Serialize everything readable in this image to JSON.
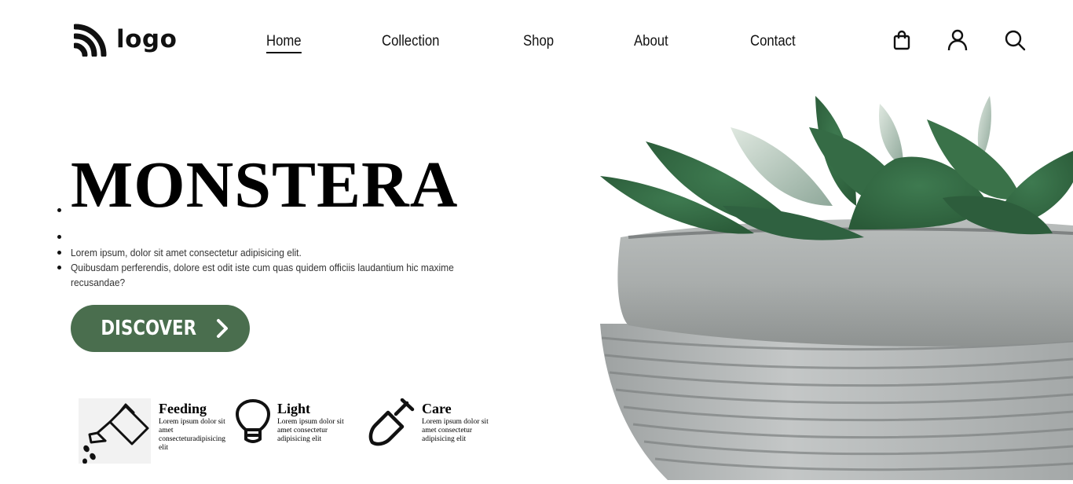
{
  "header": {
    "logo_text": "logo",
    "nav": [
      {
        "label": "Home",
        "active": true
      },
      {
        "label": "Collection",
        "active": false
      },
      {
        "label": "Shop",
        "active": false
      },
      {
        "label": "About",
        "active": false
      },
      {
        "label": "Contact",
        "active": false
      }
    ],
    "icons": [
      "shopping-bag-icon",
      "user-icon",
      "search-icon"
    ]
  },
  "hero": {
    "title": "MONSTERA",
    "lines": [
      "Lorem ipsum, dolor sit amet consectetur adipisicing elit.",
      "Quibusdam perferendis, dolore est odit iste cum quas quidem officiis laudantium hic maxime",
      "recusandae?"
    ],
    "button_label": "DISCOVER",
    "button_color": "#4a6e4e"
  },
  "features": [
    {
      "title": "Feeding",
      "text": "Lorem ipsum dolor sit amet consecteturadipisicing elit",
      "icon": "watering-can-icon"
    },
    {
      "title": "Light",
      "text": "Lorem ipsum dolor sit amet consectetur adipisicing elit",
      "icon": "light-bulb-icon"
    },
    {
      "title": "Care",
      "text": "Lorem ipsum dolor sit amet consectetur adipisicing elit",
      "icon": "shovel-icon"
    }
  ]
}
